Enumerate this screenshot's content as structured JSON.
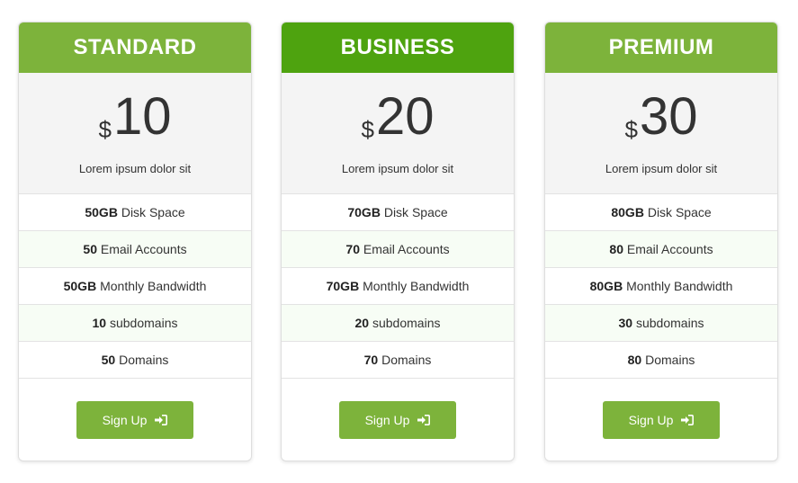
{
  "colors": {
    "standard_header": "#7db33b",
    "business_header": "#4ea30f",
    "premium_header": "#7db33b",
    "button": "#7db33b"
  },
  "plans": [
    {
      "name": "STANDARD",
      "currency": "$",
      "price": "10",
      "description": "Lorem ipsum dolor sit",
      "features": [
        {
          "value": "50GB",
          "label": "Disk Space"
        },
        {
          "value": "50",
          "label": "Email Accounts"
        },
        {
          "value": "50GB",
          "label": "Monthly Bandwidth"
        },
        {
          "value": "10",
          "label": "subdomains"
        },
        {
          "value": "50",
          "label": "Domains"
        }
      ],
      "button_label": "Sign Up",
      "button_icon": "sign-in-icon"
    },
    {
      "name": "BUSINESS",
      "currency": "$",
      "price": "20",
      "description": "Lorem ipsum dolor sit",
      "features": [
        {
          "value": "70GB",
          "label": "Disk Space"
        },
        {
          "value": "70",
          "label": "Email Accounts"
        },
        {
          "value": "70GB",
          "label": "Monthly Bandwidth"
        },
        {
          "value": "20",
          "label": "subdomains"
        },
        {
          "value": "70",
          "label": "Domains"
        }
      ],
      "button_label": "Sign Up",
      "button_icon": "sign-in-icon"
    },
    {
      "name": "PREMIUM",
      "currency": "$",
      "price": "30",
      "description": "Lorem ipsum dolor sit",
      "features": [
        {
          "value": "80GB",
          "label": "Disk Space"
        },
        {
          "value": "80",
          "label": "Email Accounts"
        },
        {
          "value": "80GB",
          "label": "Monthly Bandwidth"
        },
        {
          "value": "30",
          "label": "subdomains"
        },
        {
          "value": "80",
          "label": "Domains"
        }
      ],
      "button_label": "Sign Up",
      "button_icon": "sign-in-icon"
    }
  ]
}
